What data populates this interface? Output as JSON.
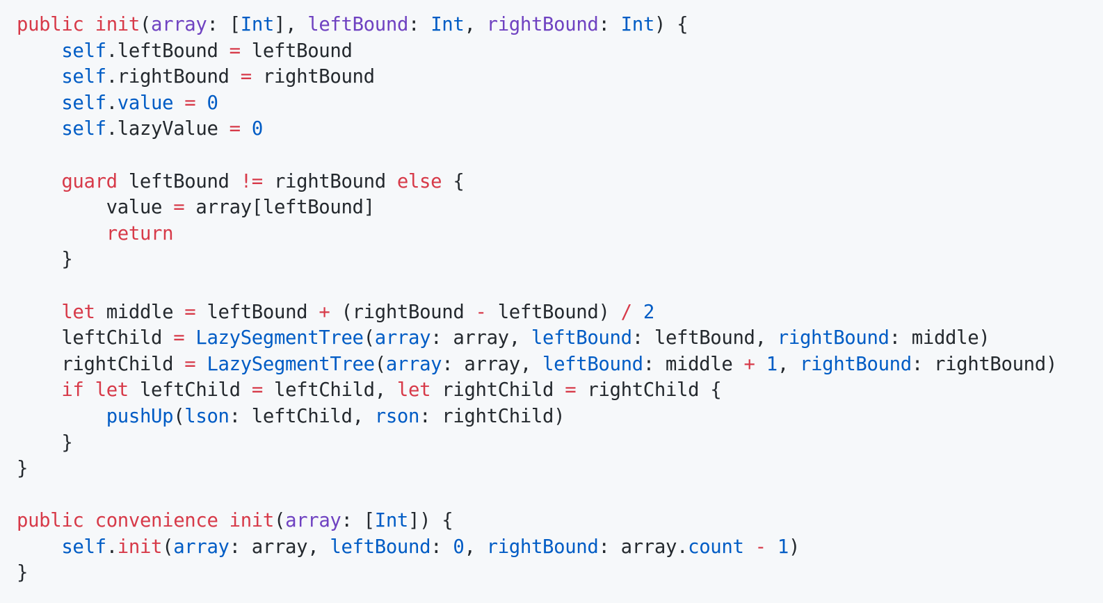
{
  "colors": {
    "background": "#f6f8fa",
    "keyword": "#d73a49",
    "type": "#005cc5",
    "param": "#6f42c1",
    "number": "#005cc5",
    "plain": "#24292e"
  },
  "code": {
    "lines": [
      [
        [
          "public",
          "kw"
        ],
        [
          " ",
          "pl"
        ],
        [
          "init",
          "kw"
        ],
        [
          "(",
          "pl"
        ],
        [
          "array",
          "pr"
        ],
        [
          ": [",
          "pl"
        ],
        [
          "Int",
          "ty"
        ],
        [
          "], ",
          "pl"
        ],
        [
          "leftBound",
          "pr"
        ],
        [
          ": ",
          "pl"
        ],
        [
          "Int",
          "ty"
        ],
        [
          ", ",
          "pl"
        ],
        [
          "rightBound",
          "pr"
        ],
        [
          ": ",
          "pl"
        ],
        [
          "Int",
          "ty"
        ],
        [
          ") {",
          "pl"
        ]
      ],
      [
        [
          "    ",
          "pl"
        ],
        [
          "self",
          "ty"
        ],
        [
          ".leftBound ",
          "pl"
        ],
        [
          "=",
          "op"
        ],
        [
          " leftBound",
          "pl"
        ]
      ],
      [
        [
          "    ",
          "pl"
        ],
        [
          "self",
          "ty"
        ],
        [
          ".rightBound ",
          "pl"
        ],
        [
          "=",
          "op"
        ],
        [
          " rightBound",
          "pl"
        ]
      ],
      [
        [
          "    ",
          "pl"
        ],
        [
          "self",
          "ty"
        ],
        [
          ".",
          "pl"
        ],
        [
          "value",
          "ty"
        ],
        [
          " ",
          "pl"
        ],
        [
          "=",
          "op"
        ],
        [
          " ",
          "pl"
        ],
        [
          "0",
          "nu"
        ]
      ],
      [
        [
          "    ",
          "pl"
        ],
        [
          "self",
          "ty"
        ],
        [
          ".lazyValue ",
          "pl"
        ],
        [
          "=",
          "op"
        ],
        [
          " ",
          "pl"
        ],
        [
          "0",
          "nu"
        ]
      ],
      [
        [
          "",
          "pl"
        ]
      ],
      [
        [
          "    ",
          "pl"
        ],
        [
          "guard",
          "kw"
        ],
        [
          " leftBound ",
          "pl"
        ],
        [
          "!=",
          "op"
        ],
        [
          " rightBound ",
          "pl"
        ],
        [
          "else",
          "kw"
        ],
        [
          " {",
          "pl"
        ]
      ],
      [
        [
          "        value ",
          "pl"
        ],
        [
          "=",
          "op"
        ],
        [
          " array[leftBound]",
          "pl"
        ]
      ],
      [
        [
          "        ",
          "pl"
        ],
        [
          "return",
          "kw"
        ]
      ],
      [
        [
          "    }",
          "pl"
        ]
      ],
      [
        [
          "",
          "pl"
        ]
      ],
      [
        [
          "    ",
          "pl"
        ],
        [
          "let",
          "kw"
        ],
        [
          " middle ",
          "pl"
        ],
        [
          "=",
          "op"
        ],
        [
          " leftBound ",
          "pl"
        ],
        [
          "+",
          "op"
        ],
        [
          " (rightBound ",
          "pl"
        ],
        [
          "-",
          "op"
        ],
        [
          " leftBound) ",
          "pl"
        ],
        [
          "/",
          "op"
        ],
        [
          " ",
          "pl"
        ],
        [
          "2",
          "nu"
        ]
      ],
      [
        [
          "    leftChild ",
          "pl"
        ],
        [
          "=",
          "op"
        ],
        [
          " ",
          "pl"
        ],
        [
          "LazySegmentTree",
          "ty"
        ],
        [
          "(",
          "pl"
        ],
        [
          "array",
          "ty"
        ],
        [
          ": array, ",
          "pl"
        ],
        [
          "leftBound",
          "ty"
        ],
        [
          ": leftBound, ",
          "pl"
        ],
        [
          "rightBound",
          "ty"
        ],
        [
          ": middle)",
          "pl"
        ]
      ],
      [
        [
          "    rightChild ",
          "pl"
        ],
        [
          "=",
          "op"
        ],
        [
          " ",
          "pl"
        ],
        [
          "LazySegmentTree",
          "ty"
        ],
        [
          "(",
          "pl"
        ],
        [
          "array",
          "ty"
        ],
        [
          ": array, ",
          "pl"
        ],
        [
          "leftBound",
          "ty"
        ],
        [
          ": middle ",
          "pl"
        ],
        [
          "+",
          "op"
        ],
        [
          " ",
          "pl"
        ],
        [
          "1",
          "nu"
        ],
        [
          ", ",
          "pl"
        ],
        [
          "rightBound",
          "ty"
        ],
        [
          ": rightBound)",
          "pl"
        ]
      ],
      [
        [
          "    ",
          "pl"
        ],
        [
          "if",
          "kw"
        ],
        [
          " ",
          "pl"
        ],
        [
          "let",
          "kw"
        ],
        [
          " leftChild ",
          "pl"
        ],
        [
          "=",
          "op"
        ],
        [
          " leftChild, ",
          "pl"
        ],
        [
          "let",
          "kw"
        ],
        [
          " rightChild ",
          "pl"
        ],
        [
          "=",
          "op"
        ],
        [
          " rightChild {",
          "pl"
        ]
      ],
      [
        [
          "        ",
          "pl"
        ],
        [
          "pushUp",
          "ty"
        ],
        [
          "(",
          "pl"
        ],
        [
          "lson",
          "ty"
        ],
        [
          ": leftChild, ",
          "pl"
        ],
        [
          "rson",
          "ty"
        ],
        [
          ": rightChild)",
          "pl"
        ]
      ],
      [
        [
          "    }",
          "pl"
        ]
      ],
      [
        [
          "}",
          "pl"
        ]
      ],
      [
        [
          "",
          "pl"
        ]
      ],
      [
        [
          "public",
          "kw"
        ],
        [
          " ",
          "pl"
        ],
        [
          "convenience",
          "kw"
        ],
        [
          " ",
          "pl"
        ],
        [
          "init",
          "kw"
        ],
        [
          "(",
          "pl"
        ],
        [
          "array",
          "pr"
        ],
        [
          ": [",
          "pl"
        ],
        [
          "Int",
          "ty"
        ],
        [
          "]) {",
          "pl"
        ]
      ],
      [
        [
          "    ",
          "pl"
        ],
        [
          "self",
          "ty"
        ],
        [
          ".",
          "pl"
        ],
        [
          "init",
          "kw"
        ],
        [
          "(",
          "pl"
        ],
        [
          "array",
          "ty"
        ],
        [
          ": array, ",
          "pl"
        ],
        [
          "leftBound",
          "ty"
        ],
        [
          ": ",
          "pl"
        ],
        [
          "0",
          "nu"
        ],
        [
          ", ",
          "pl"
        ],
        [
          "rightBound",
          "ty"
        ],
        [
          ": array.",
          "pl"
        ],
        [
          "count",
          "ty"
        ],
        [
          " ",
          "pl"
        ],
        [
          "-",
          "op"
        ],
        [
          " ",
          "pl"
        ],
        [
          "1",
          "nu"
        ],
        [
          ")",
          "pl"
        ]
      ],
      [
        [
          "}",
          "pl"
        ]
      ]
    ]
  }
}
